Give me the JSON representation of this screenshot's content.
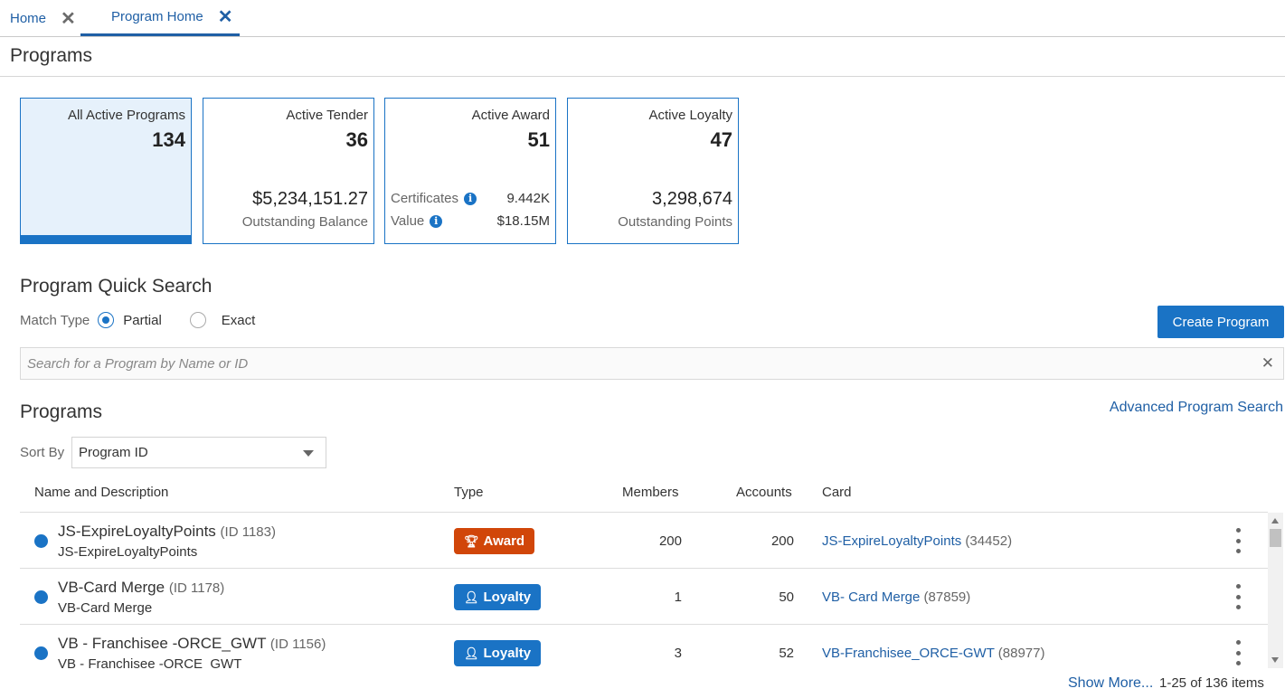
{
  "tabs": [
    {
      "label": "Home",
      "close_icon": "close-icon"
    },
    {
      "label": "Program Home",
      "close_icon": "close-icon",
      "active": true
    }
  ],
  "page": {
    "title": "Programs"
  },
  "summary_tiles": [
    {
      "title": "All Active Programs",
      "count": "134",
      "selected": true
    },
    {
      "title": "Active Tender",
      "count": "36",
      "amount": "$5,234,151.27",
      "sub": "Outstanding Balance"
    },
    {
      "title": "Active Award",
      "count": "51",
      "rows": [
        {
          "label": "Certificates",
          "icon": "info-icon",
          "value": "9.442K"
        },
        {
          "label": "Value",
          "icon": "info-icon",
          "value": "$18.15M"
        }
      ]
    },
    {
      "title": "Active Loyalty",
      "count": "47",
      "amount": "3,298,674",
      "sub": "Outstanding Points"
    }
  ],
  "quick_search": {
    "title": "Program Quick Search",
    "match_type_label": "Match Type",
    "options": [
      {
        "label": "Partial",
        "checked": true
      },
      {
        "label": "Exact",
        "checked": false
      }
    ],
    "placeholder": "Search for a Program by Name or ID",
    "create_button": "Create Program"
  },
  "programs": {
    "title": "Programs",
    "advanced_search": "Advanced Program Search",
    "sort_by_label": "Sort By",
    "sort_by_value": "Program ID",
    "columns": [
      "Name and Description",
      "Type",
      "Members",
      "Accounts",
      "Card"
    ],
    "rows": [
      {
        "name": "JS-ExpireLoyaltyPoints",
        "id": "(ID 1183)",
        "description": "JS-ExpireLoyaltyPoints",
        "type": "Award",
        "type_icon": "trophy-icon",
        "members": "200",
        "accounts": "200",
        "card": "JS-ExpireLoyaltyPoints",
        "card_id": "(34452)"
      },
      {
        "name": "VB-Card Merge",
        "id": "(ID 1178)",
        "description": "VB-Card Merge",
        "type": "Loyalty",
        "type_icon": "person-icon",
        "members": "1",
        "accounts": "50",
        "card": "VB- Card Merge",
        "card_id": "(87859)"
      },
      {
        "name": "VB - Franchisee -ORCE_GWT",
        "id": "(ID 1156)",
        "description": "VB - Franchisee -ORCE_GWT",
        "type": "Loyalty",
        "type_icon": "person-icon",
        "members": "3",
        "accounts": "52",
        "card": "VB-Franchisee_ORCE-GWT",
        "card_id": "(88977)"
      }
    ],
    "show_more": "Show More...",
    "item_count": "1-25 of 136 items"
  },
  "colors": {
    "accent": "#1a73c5",
    "award": "#d14609",
    "link": "#1f5fa5"
  }
}
